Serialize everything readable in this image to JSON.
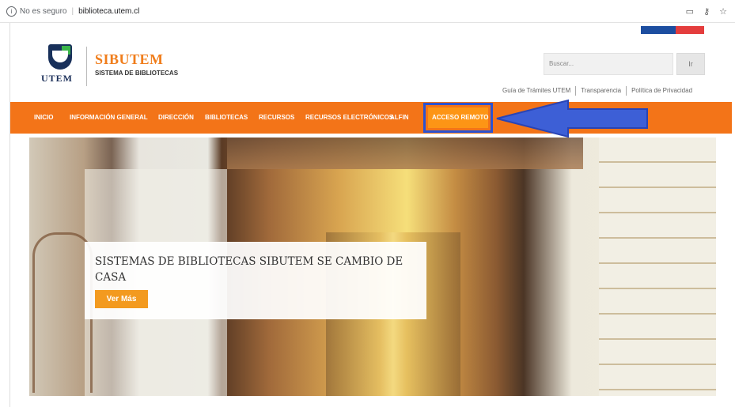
{
  "browser": {
    "security_text": "No es seguro",
    "url": "biblioteca.utem.cl"
  },
  "header": {
    "logo_text": "UTEM",
    "brand": "SIBUTEM",
    "brand_sub": "SISTEMA DE BIBLIOTECAS",
    "search_placeholder": "Buscar...",
    "search_button": "Ir",
    "links": [
      "Guía de Trámites UTEM",
      "Transparencia",
      "Política de Privacidad"
    ]
  },
  "nav": {
    "items": [
      "INICIO",
      "INFORMACIÓN GENERAL",
      "DIRECCIÓN",
      "BIBLIOTECAS",
      "RECURSOS",
      "RECURSOS ELECTRÓNICOS",
      "ALFIN",
      "ACCESO REMOTO"
    ]
  },
  "hero": {
    "title": "SISTEMAS DE BIBLIOTECAS SIBUTEM SE CAMBIO DE CASA",
    "button": "Ver Más"
  },
  "colors": {
    "nav": "#f37418",
    "brand": "#f07d1b",
    "highlight_border": "#2b52d1",
    "arrow": "#3d5fd6"
  }
}
